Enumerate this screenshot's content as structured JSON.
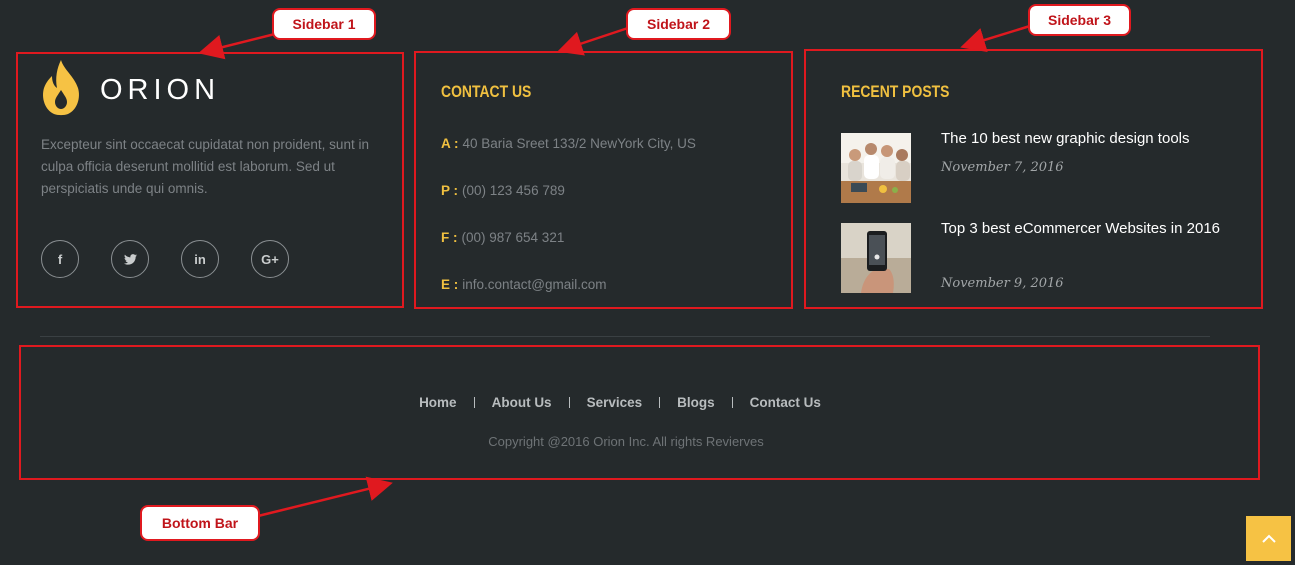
{
  "callouts": {
    "sidebar1": "Sidebar 1",
    "sidebar2": "Sidebar 2",
    "sidebar3": "Sidebar 3",
    "bottom": "Bottom Bar"
  },
  "sidebar1": {
    "brand": "ORION",
    "about": "Excepteur sint occaecat cupidatat non proident, sunt in culpa officia deserunt mollitid est laborum. Sed ut perspiciatis unde qui omnis.",
    "social": [
      {
        "icon": "facebook-icon",
        "glyph": "f"
      },
      {
        "icon": "twitter-icon",
        "glyph": "t"
      },
      {
        "icon": "linkedin-icon",
        "glyph": "in"
      },
      {
        "icon": "google-plus-icon",
        "glyph": "G+"
      }
    ]
  },
  "sidebar2": {
    "title": "CONTACT US",
    "rows": [
      {
        "label": "A :",
        "value": "40 Baria Sreet 133/2 NewYork City, US"
      },
      {
        "label": "P :",
        "value": "(00) 123 456 789"
      },
      {
        "label": "F :",
        "value": "(00) 987 654 321"
      },
      {
        "label": "E :",
        "value": "info.contact@gmail.com"
      }
    ]
  },
  "sidebar3": {
    "title": "RECENT POSTS",
    "posts": [
      {
        "title": "The 10 best new graphic design tools",
        "date": "November 7, 2016"
      },
      {
        "title": "Top 3 best eCommercer Websites in 2016",
        "date": "November 9, 2016"
      }
    ]
  },
  "footer": {
    "nav": [
      "Home",
      "About Us",
      "Services",
      "Blogs",
      "Contact Us"
    ],
    "copyright": "Copyright @2016 Orion Inc. All rights Revierves"
  },
  "colors": {
    "background": "#252a2c",
    "accent": "#f0c040",
    "annotation": "#e0191f"
  }
}
